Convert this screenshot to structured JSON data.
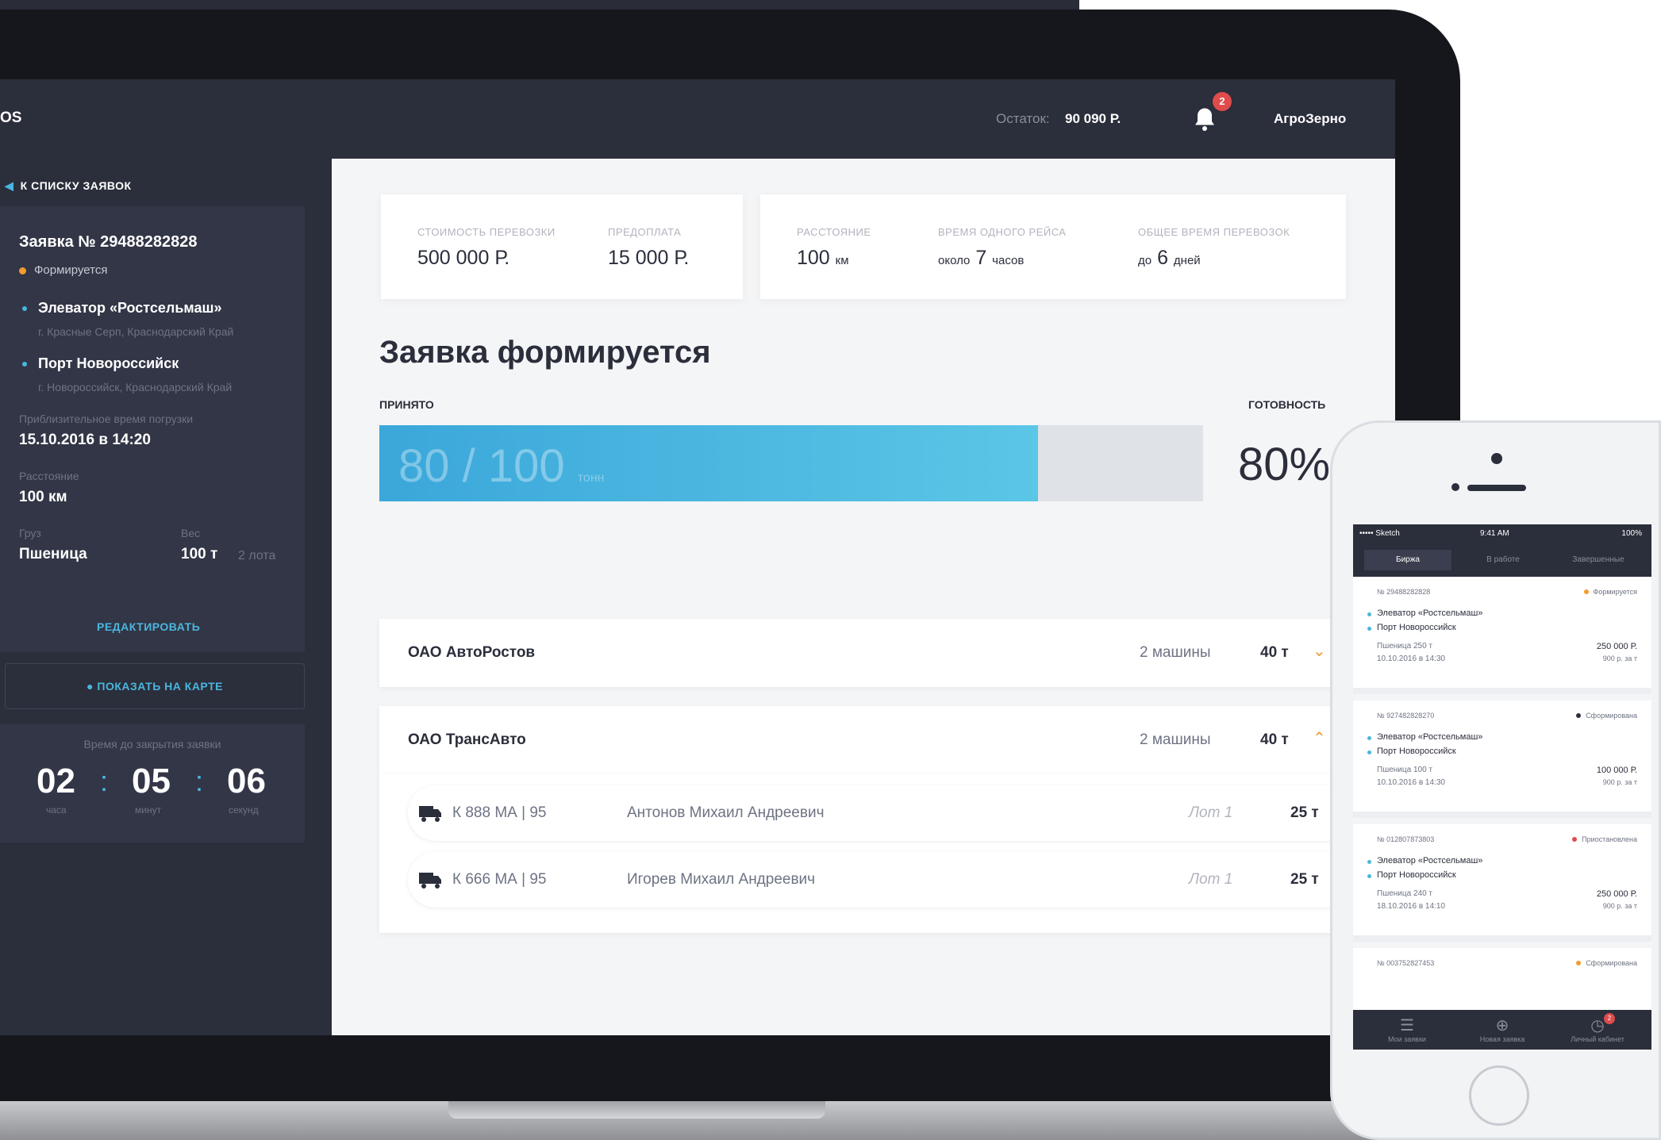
{
  "header": {
    "logo": "OS",
    "balance_label": "Остаток:",
    "balance_value": "90 090 Р.",
    "notifications_count": "2",
    "user_name": "АгроЗерно"
  },
  "sidebar": {
    "back_label": "К СПИСКУ ЗАЯВОК",
    "order_title": "Заявка № 29488282828",
    "order_status": "Формируется",
    "route": [
      {
        "name": "Элеватор «Ростсельмаш»",
        "address": "г. Красные Серп, Краснодарский Край"
      },
      {
        "name": "Порт Новороссийск",
        "address": "г. Новороссийск, Краснодарский Край"
      }
    ],
    "loading_time_label": "Приблизительное время погрузки",
    "loading_time_value": "15.10.2016  в  14:20",
    "distance_label": "Расстояние",
    "distance_value": "100 км",
    "cargo_label": "Груз",
    "cargo_value": "Пшеница",
    "weight_label": "Вес",
    "weight_value": "100 т",
    "weight_extra": "2 лота",
    "edit_label": "РЕДАКТИРОВАТЬ",
    "map_button_label": "ПОКАЗАТЬ НА КАРТЕ",
    "timer": {
      "label": "Время до закрытия заявки",
      "hours": "02",
      "minutes": "05",
      "seconds": "06",
      "hours_unit": "часа",
      "minutes_unit": "минут",
      "seconds_unit": "секунд",
      "separator": ":"
    }
  },
  "stats": {
    "cost_label": "СТОИМОСТЬ ПЕРЕВОЗКИ",
    "cost_value": "500 000 Р.",
    "prepay_label": "ПРЕДОПЛАТА",
    "prepay_value": "15 000 Р.",
    "distance_label": "РАССТОЯНИЕ",
    "distance_value": "100",
    "distance_unit": "км",
    "trip_time_label": "ВРЕМЯ ОДНОГО РЕЙСА",
    "trip_time_prefix": "около",
    "trip_time_value": "7",
    "trip_time_unit": "часов",
    "total_time_label": "ОБЩЕЕ ВРЕМЯ ПЕРЕВОЗОК",
    "total_time_prefix": "до",
    "total_time_value": "6",
    "total_time_unit": "дней"
  },
  "progress": {
    "heading": "Заявка формируется",
    "accepted_label": "ПРИНЯТО",
    "readiness_label": "ГОТОВНОСТЬ",
    "accepted_text": "80 / 100",
    "accepted_unit": "тонн",
    "fraction": 0.8,
    "percent_text": "80%"
  },
  "carriers": [
    {
      "name": "ОАО АвтоРостов",
      "cars": "2 машины",
      "weight": "40 т"
    },
    {
      "name": "ОАО ТрансАвто",
      "cars": "2 машины",
      "weight": "40 т"
    }
  ],
  "vehicles": [
    {
      "plate": "К 888 МА | 95",
      "driver": "Антонов Михаил Андреевич",
      "lot": "Лот 1",
      "weight": "25 т"
    },
    {
      "plate": "К 666 МА | 95",
      "driver": "Игорев Михаил Андреевич",
      "lot": "Лот 1",
      "weight": "25 т"
    }
  ],
  "icons": {
    "back": "chevron-left-icon",
    "bell": "bell-icon",
    "map_pin": "map-pin-icon",
    "truck": "truck-icon",
    "expand": "chevron-down-icon"
  },
  "colors": {
    "accent": "#4ab6de",
    "status_forming": "#f39b2f",
    "badge": "#e04b4b",
    "dark_bg": "#2b2e3b"
  },
  "phone": {
    "status_carrier": "••••• Sketch",
    "status_time": "9:41 AM",
    "status_battery": "100%",
    "tabs": [
      "Биржа",
      "В работе",
      "Завершенные"
    ],
    "cards": [
      {
        "number": "№ 29488282828",
        "status": "Формируется",
        "status_color": "#f39b2f",
        "from": "Элеватор «Ростсельмаш»",
        "to": "Порт Новороссийск",
        "cargo": "Пшеница  250 т",
        "date": "10.10.2016  в  14:30",
        "price": "250 000 Р.",
        "price_rate": "900 р. за т"
      },
      {
        "number": "№ 927482828270",
        "status": "Сформирована",
        "status_color": "#2b2e3b",
        "from": "Элеватор «Ростсельмаш»",
        "to": "Порт Новороссийск",
        "cargo": "Пшеница  100 т",
        "date": "10.10.2016  в  14:30",
        "price": "100 000 Р.",
        "price_rate": "900 р. за т"
      },
      {
        "number": "№ 012807873803",
        "status": "Приостановлена",
        "status_color": "#e04b4b",
        "from": "Элеватор «Ростсельмаш»",
        "to": "Порт Новороссийск",
        "cargo": "Пшеница  240 т",
        "date": "18.10.2016  в  14:10",
        "price": "250 000 Р.",
        "price_rate": "900 р. за т"
      },
      {
        "number": "№ 003752827453",
        "status": "Сформирована",
        "status_color": "#f39b2f"
      }
    ],
    "bottom_nav": [
      "Мои заявки",
      "Новая заявка",
      "Личный кабинет"
    ],
    "bottom_badge": "2"
  }
}
